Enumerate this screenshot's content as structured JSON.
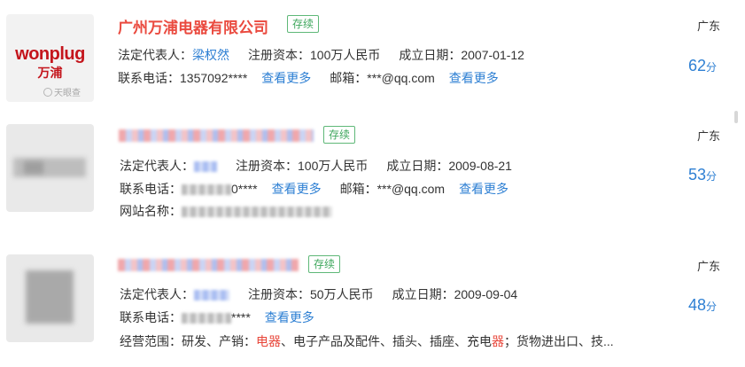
{
  "results": [
    {
      "logo": {
        "text_en": "wonplug",
        "text_cn": "万浦",
        "watermark": "天眼查"
      },
      "name": "广州万浦电器有限公司",
      "status": "存续",
      "legal_rep_label": "法定代表人：",
      "legal_rep": "梁权然",
      "capital_label": "注册资本：",
      "capital": "100万人民币",
      "founded_label": "成立日期：",
      "founded": "2007-01-12",
      "phone_label": "联系电话：",
      "phone": "1357092****",
      "more_label": "查看更多",
      "email_label": "邮箱：",
      "email": "***@qq.com",
      "region": "广东",
      "score": "62",
      "score_unit": "分"
    },
    {
      "status": "存续",
      "legal_rep_label": "法定代表人：",
      "capital_label": "注册资本：",
      "capital": "100万人民币",
      "founded_label": "成立日期：",
      "founded": "2009-08-21",
      "phone_label": "联系电话：",
      "phone_suffix": "0****",
      "more_label": "查看更多",
      "email_label": "邮箱：",
      "email": "***@qq.com",
      "website_label": "网站名称：",
      "region": "广东",
      "score": "53",
      "score_unit": "分"
    },
    {
      "status": "存续",
      "legal_rep_label": "法定代表人：",
      "capital_label": "注册资本：",
      "capital": "50万人民币",
      "founded_label": "成立日期：",
      "founded": "2009-09-04",
      "phone_label": "联系电话：",
      "phone_suffix": "****",
      "more_label": "查看更多",
      "scope_label": "经营范围：",
      "scope_part1": "研发、产销：",
      "scope_hl1": "电器",
      "scope_part2": "、电子产品及配件、插头、插座、充电",
      "scope_hl2": "器",
      "scope_part3": "；货物进出口、技...",
      "region": "广东",
      "score": "48",
      "score_unit": "分"
    }
  ]
}
